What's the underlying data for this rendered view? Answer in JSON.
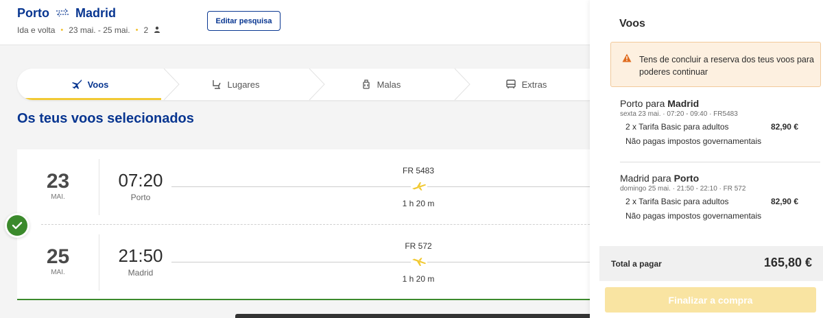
{
  "header": {
    "origin": "Porto",
    "destination": "Madrid",
    "trip_type": "Ida e volta",
    "dates": "23 mai. - 25 mai.",
    "passengers": "2",
    "edit_label": "Editar pesquisa"
  },
  "steps": [
    {
      "label": "Voos",
      "icon": "plane-icon"
    },
    {
      "label": "Lugares",
      "icon": "seat-icon"
    },
    {
      "label": "Malas",
      "icon": "luggage-icon"
    },
    {
      "label": "Extras",
      "icon": "bus-icon"
    }
  ],
  "main": {
    "title": "Os teus voos selecionados"
  },
  "flights": [
    {
      "day": "23",
      "month": "MAI.",
      "time": "07:20",
      "city": "Porto",
      "flight_no": "FR 5483",
      "duration": "1 h 20 m"
    },
    {
      "day": "25",
      "month": "MAI.",
      "time": "21:50",
      "city": "Madrid",
      "flight_no": "FR 572",
      "duration": "1 h 20 m"
    }
  ],
  "sidebar": {
    "title": "Voos",
    "alert": "Tens de concluir a reserva dos teus voos para poderes continuar",
    "segments": [
      {
        "from_text": "Porto para ",
        "to_city": "Madrid",
        "details": "sexta 23 mai.  ·  07:20 - 09:40  ·  FR5483",
        "fare": "2 x Tarifa Basic para adultos",
        "price": "82,90 €",
        "note": "Não pagas impostos governamentais"
      },
      {
        "from_text": "Madrid para ",
        "to_city": "Porto",
        "details": "domingo 25 mai.  ·  21:50 - 22:10  ·  FR 572",
        "fare": "2 x Tarifa Basic para adultos",
        "price": "82,90 €",
        "note": "Não pagas impostos governamentais"
      }
    ],
    "total_label": "Total a pagar",
    "total_value": "165,80 €",
    "checkout_label": "Finalizar a compra"
  },
  "colors": {
    "brand_blue": "#073590",
    "accent_yellow": "#f1c933",
    "success_green": "#3b8a2c",
    "warning_orange": "#e06c1e"
  }
}
